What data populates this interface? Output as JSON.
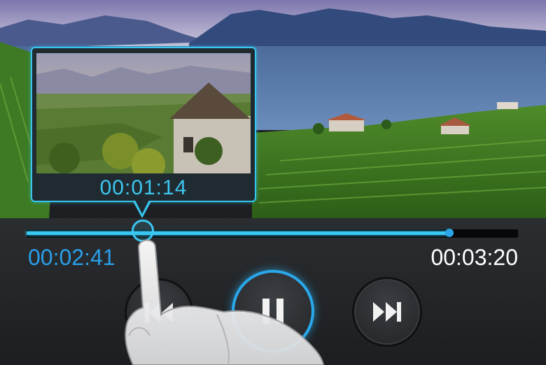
{
  "player": {
    "preview_time": "00:01:14",
    "elapsed_time": "00:02:41",
    "total_time": "00:03:20",
    "seek_progress": 0.237,
    "buffer_progress": 0.86,
    "state": "playing"
  },
  "controls": {
    "previous_icon": "skip-previous-icon",
    "pause_icon": "pause-icon",
    "next_icon": "skip-next-icon"
  },
  "colors": {
    "accent": "#36c6ee",
    "elapsed_text": "#2a9ee8",
    "duration_text": "#ffffff",
    "panel_bg": "#26292c"
  }
}
